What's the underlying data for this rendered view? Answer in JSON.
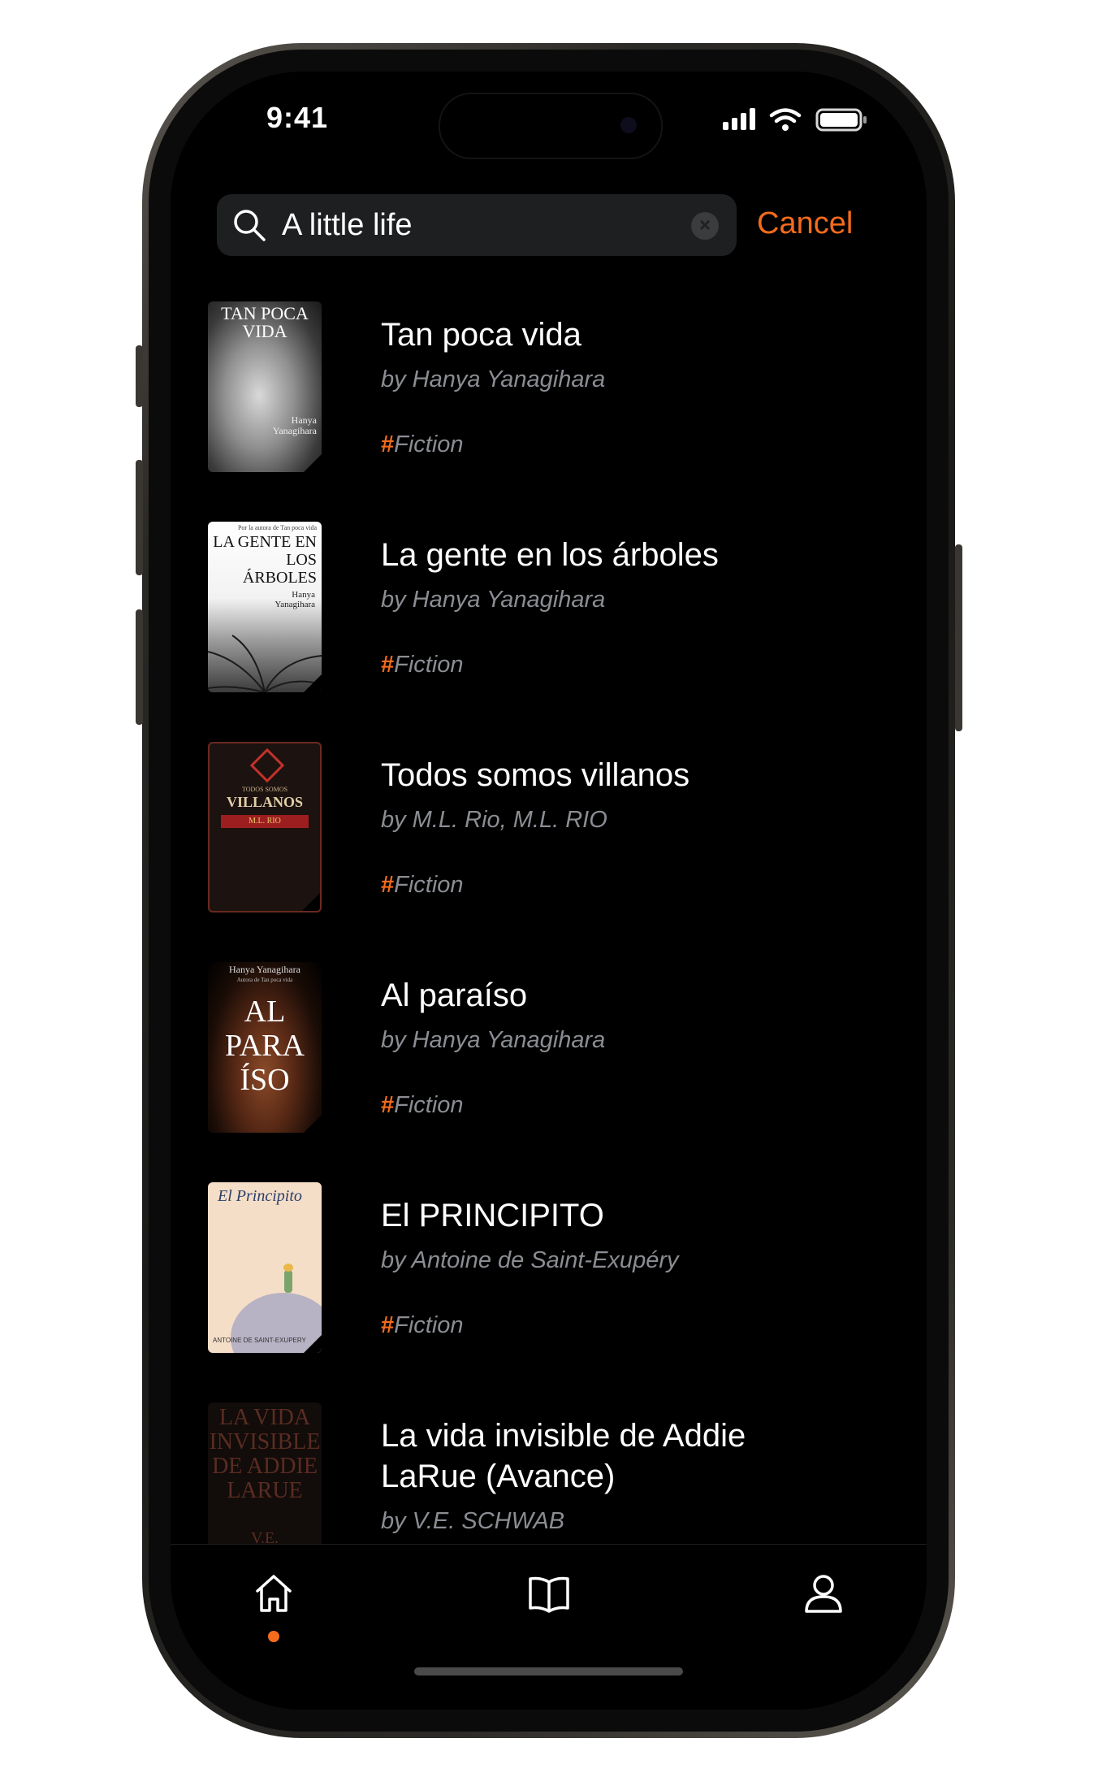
{
  "status_bar": {
    "time": "9:41"
  },
  "search": {
    "query": "A little life",
    "cancel_label": "Cancel"
  },
  "results": [
    {
      "title": "Tan poca vida",
      "author": "by Hanya Yanagihara",
      "tag": "Fiction",
      "cover_text": {
        "title": "TAN POCA VIDA",
        "author": "Hanya Yanagihara"
      }
    },
    {
      "title": "La gente en los árboles",
      "author": "by Hanya Yanagihara",
      "tag": "Fiction",
      "cover_text": {
        "top": "Por la autora de Tan poca vida",
        "title": "LA GENTE EN LOS ÁRBOLES",
        "author": "Hanya Yanagihara"
      }
    },
    {
      "title": "Todos somos villanos",
      "author": "by M.L. Rio, M.L. RIO",
      "tag": "Fiction",
      "cover_text": {
        "top": "TODOS SOMOS",
        "title": "VILLANOS",
        "author": "M.L. RIO"
      }
    },
    {
      "title": "Al paraíso",
      "author": "by Hanya Yanagihara",
      "tag": "Fiction",
      "cover_text": {
        "top": "Hanya Yanagihara",
        "subtitle": "Autora de Tan poca vida",
        "title": "AL PARA ÍSO"
      }
    },
    {
      "title": "El PRINCIPITO",
      "author": "by Antoine de Saint-Exupéry",
      "tag": "Fiction",
      "cover_text": {
        "title": "El Principito",
        "author": "ANTOINE DE SAINT-EXUPERY"
      }
    },
    {
      "title": "La vida invisible de Addie LaRue (Avance)",
      "author": "by V.E. SCHWAB",
      "tag": "",
      "cover_text": {
        "title": "LA VIDA INVISIBLE DE ADDIE LARUE",
        "author": "V.E."
      }
    }
  ],
  "tabbar": {
    "items": [
      "home",
      "library",
      "profile"
    ],
    "active": "home"
  },
  "colors": {
    "accent": "#f46b1c",
    "background": "#000000",
    "secondary_text": "#8a8d92"
  }
}
